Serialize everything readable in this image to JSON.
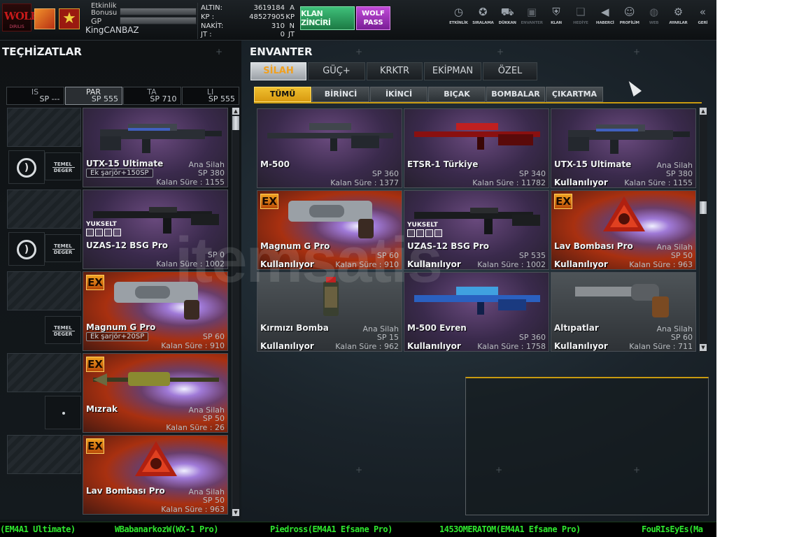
{
  "topbar": {
    "logo_text": "WOLF",
    "logo_sub": "DIRILIS",
    "bonus_label": "Etkinlik Bonusu",
    "gp_label": "GP",
    "username": "KingCANBAZ",
    "currency": [
      {
        "label": "ALTIN:",
        "value": "3619184",
        "unit": "A"
      },
      {
        "label": "KP :",
        "value": "48527905",
        "unit": "KP"
      },
      {
        "label": "NAKİT:",
        "value": "310",
        "unit": "N"
      },
      {
        "label": "JT :",
        "value": "0",
        "unit": "JT"
      }
    ],
    "klan_label": "KLAN ZİNCİRİ",
    "wolf_pass_label": "WOLF PASS",
    "nav": [
      {
        "icon": "clock-icon",
        "label": "ETKİNLİK",
        "dim": false
      },
      {
        "icon": "medal-icon",
        "label": "SIRALAMA",
        "dim": false
      },
      {
        "icon": "cart-icon",
        "label": "DÜKKAN",
        "dim": false
      },
      {
        "icon": "film-icon",
        "label": "ENVANTER",
        "dim": true
      },
      {
        "icon": "shield-icon",
        "label": "KLAN",
        "dim": false
      },
      {
        "icon": "gift-icon",
        "label": "HEDİYE",
        "dim": true
      },
      {
        "icon": "megaphone-icon",
        "label": "HABERCİ",
        "dim": false
      },
      {
        "icon": "person-icon",
        "label": "PROFİLİM",
        "dim": false
      },
      {
        "icon": "globe-icon",
        "label": "WEB",
        "dim": true
      },
      {
        "icon": "gear-icon",
        "label": "AYARLAR",
        "dim": false
      },
      {
        "icon": "back-icon",
        "label": "GERİ",
        "dim": false
      }
    ]
  },
  "left": {
    "title": "TEÇHİZATLAR",
    "class_tabs": [
      {
        "name": "IS",
        "sp": "SP ---",
        "active": false
      },
      {
        "name": "PAR",
        "sp": "SP 555",
        "active": true
      },
      {
        "name": "TA",
        "sp": "SP 710",
        "active": false
      },
      {
        "name": "LI",
        "sp": "SP 555",
        "active": false
      }
    ],
    "temel_label": "TEMEL DEĞER",
    "equipped": [
      {
        "name": "UTX-15 Ultimate",
        "type": "Ana Silah",
        "sp": "SP 380",
        "time": "Kalan Süre : 1155",
        "extra": "Ek şarjör+150SP",
        "bg": "purple",
        "ex": false,
        "yukselt": false
      },
      {
        "name": "UZAS-12 BSG Pro",
        "type": "",
        "sp": "SP 0",
        "time": "Kalan Süre : 1002",
        "extra": "",
        "bg": "purple",
        "ex": false,
        "yukselt": true
      },
      {
        "name": "Magnum G Pro",
        "type": "",
        "sp": "SP 60",
        "time": "Kalan Süre : 910",
        "extra": "Ek şarjör+20SP",
        "bg": "fire",
        "ex": true,
        "yukselt": false
      },
      {
        "name": "Mızrak",
        "type": "Ana Silah",
        "sp": "SP 50",
        "time": "Kalan Süre : 26",
        "extra": "",
        "bg": "fire",
        "ex": true,
        "yukselt": false
      },
      {
        "name": "Lav Bombası Pro",
        "type": "Ana Silah",
        "sp": "SP 50",
        "time": "Kalan Süre : 963",
        "extra": "",
        "bg": "fire",
        "ex": true,
        "yukselt": false
      }
    ]
  },
  "right": {
    "title": "ENVANTER",
    "main_tabs": [
      {
        "label": "SİLAH",
        "active": true
      },
      {
        "label": "GÜÇ+",
        "active": false
      },
      {
        "label": "KRKTR",
        "active": false
      },
      {
        "label": "EKİPMAN",
        "active": false
      },
      {
        "label": "ÖZEL",
        "active": false
      }
    ],
    "filter_tabs": [
      {
        "label": "TÜMÜ",
        "active": true
      },
      {
        "label": "BİRİNCİ",
        "active": false
      },
      {
        "label": "İKİNCİ",
        "active": false
      },
      {
        "label": "BIÇAK",
        "active": false
      },
      {
        "label": "BOMBALAR",
        "active": false
      },
      {
        "label": "ÇIKARTMA",
        "active": false
      }
    ],
    "inventory": [
      {
        "name": "M-500",
        "type": "",
        "sp": "SP 360",
        "time": "Kalan Süre : 1377",
        "use": "",
        "bg": "purple",
        "ex": false,
        "yukselt": false
      },
      {
        "name": "ETSR-1 Türkiye",
        "type": "",
        "sp": "SP 340",
        "time": "Kalan Süre : 11782",
        "use": "",
        "bg": "purple",
        "ex": false,
        "yukselt": false
      },
      {
        "name": "UTX-15 Ultimate",
        "type": "Ana Silah",
        "sp": "SP 380",
        "time": "Kalan Süre : 1155",
        "use": "Kullanılıyor",
        "bg": "purple",
        "ex": false,
        "yukselt": false
      },
      {
        "name": "Magnum G Pro",
        "type": "",
        "sp": "SP 60",
        "time": "Kalan Süre : 910",
        "use": "Kullanılıyor",
        "bg": "fire",
        "ex": true,
        "yukselt": false
      },
      {
        "name": "UZAS-12 BSG Pro",
        "type": "",
        "sp": "SP 535",
        "time": "Kalan Süre : 1002",
        "use": "Kullanılıyor",
        "bg": "purple",
        "ex": false,
        "yukselt": true
      },
      {
        "name": "Lav Bombası Pro",
        "type": "Ana Silah",
        "sp": "SP 50",
        "time": "Kalan Süre : 963",
        "use": "Kullanılıyor",
        "bg": "fire",
        "ex": true,
        "yukselt": false
      },
      {
        "name": "Kırmızı Bomba",
        "type": "Ana Silah",
        "sp": "SP 15",
        "time": "Kalan Süre : 962",
        "use": "Kullanılıyor",
        "bg": "gray",
        "ex": false,
        "yukselt": false
      },
      {
        "name": "M-500 Evren",
        "type": "",
        "sp": "SP 360",
        "time": "Kalan Süre : 1758",
        "use": "Kullanılıyor",
        "bg": "purple",
        "ex": false,
        "yukselt": false
      },
      {
        "name": "Altıpatlar",
        "type": "Ana Silah",
        "sp": "SP 60",
        "time": "Kalan Süre : 711",
        "use": "Kullanılıyor",
        "bg": "gray",
        "ex": false,
        "yukselt": false
      }
    ],
    "ex_label": "EX",
    "yukselt_label": "YUKSELT"
  },
  "ticker": [
    "(EM4A1 Ultimate)",
    "WBabanarkozW(WX-1 Pro)",
    "Piedross(EM4A1 Efsane Pro)",
    "1453OMERATOM(EM4A1 Efsane Pro)",
    "FouRIsEyEs(Ma"
  ],
  "watermark": "itemsatis",
  "colors": {
    "accent": "#f0a020",
    "ticker": "#2ee82e",
    "active_tab": "#f0c030"
  }
}
